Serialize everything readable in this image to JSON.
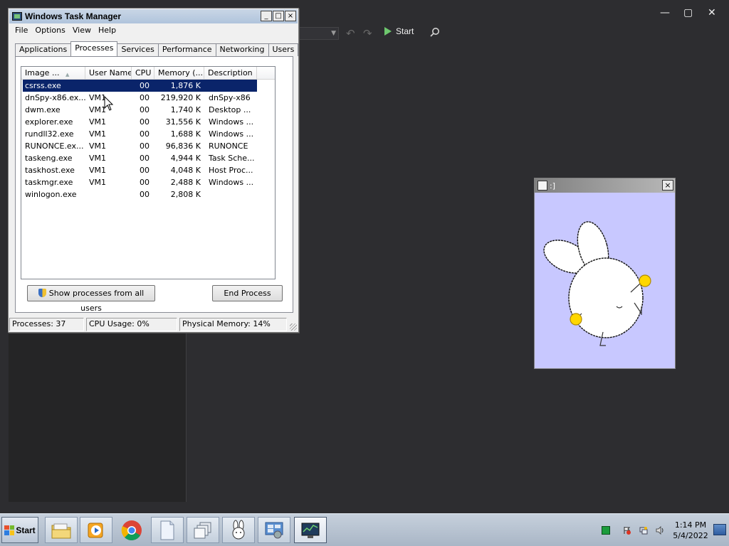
{
  "background_app": {
    "toolbar": {
      "start_label": "Start"
    },
    "window_controls": {
      "minimize": "—",
      "maximize": "▢",
      "close": "✕"
    }
  },
  "task_manager": {
    "title": "Windows Task Manager",
    "title_buttons": {
      "minimize": "_",
      "maximize": "□",
      "close": "×"
    },
    "menu": [
      "File",
      "Options",
      "View",
      "Help"
    ],
    "tabs": [
      "Applications",
      "Processes",
      "Services",
      "Performance",
      "Networking",
      "Users"
    ],
    "active_tab": "Processes",
    "columns": [
      "Image ...",
      "User Name",
      "CPU",
      "Memory (...",
      "Description"
    ],
    "processes": [
      {
        "image": "csrss.exe",
        "user": "",
        "cpu": "00",
        "memory": "1,876 K",
        "description": "",
        "selected": true
      },
      {
        "image": "dnSpy-x86.ex...",
        "user": "VM1",
        "cpu": "00",
        "memory": "219,920 K",
        "description": "dnSpy-x86"
      },
      {
        "image": "dwm.exe",
        "user": "VM1",
        "cpu": "00",
        "memory": "1,740 K",
        "description": "Desktop ..."
      },
      {
        "image": "explorer.exe",
        "user": "VM1",
        "cpu": "00",
        "memory": "31,556 K",
        "description": "Windows ..."
      },
      {
        "image": "rundll32.exe",
        "user": "VM1",
        "cpu": "00",
        "memory": "1,688 K",
        "description": "Windows ..."
      },
      {
        "image": "RUNONCE.ex...",
        "user": "VM1",
        "cpu": "00",
        "memory": "96,836 K",
        "description": "RUNONCE"
      },
      {
        "image": "taskeng.exe",
        "user": "VM1",
        "cpu": "00",
        "memory": "4,944 K",
        "description": "Task Sche..."
      },
      {
        "image": "taskhost.exe",
        "user": "VM1",
        "cpu": "00",
        "memory": "4,048 K",
        "description": "Host Proc..."
      },
      {
        "image": "taskmgr.exe",
        "user": "VM1",
        "cpu": "00",
        "memory": "2,488 K",
        "description": "Windows ..."
      },
      {
        "image": "winlogon.exe",
        "user": "",
        "cpu": "00",
        "memory": "2,808 K",
        "description": ""
      }
    ],
    "show_all_button": "Show processes from all users",
    "end_process_button": "End Process",
    "status": {
      "processes": "Processes: 37",
      "cpu": "CPU Usage: 0%",
      "memory": "Physical Memory: 14%"
    }
  },
  "bunny_window": {
    "title": ":]",
    "close": "×",
    "background_color": "#c8c8ff"
  },
  "taskbar": {
    "start_label": "Start",
    "apps": [
      {
        "icon": "folder-icon",
        "active": false
      },
      {
        "icon": "media-player-icon",
        "active": false
      },
      {
        "icon": "chrome-icon",
        "active": false
      },
      {
        "icon": "document-icon",
        "active": false
      },
      {
        "icon": "window-switch-icon",
        "active": false
      },
      {
        "icon": "bunny-icon",
        "active": false
      },
      {
        "icon": "network-settings-icon",
        "active": false
      },
      {
        "icon": "task-manager-icon",
        "active": true
      }
    ],
    "clock_time": "1:14 PM",
    "clock_date": "5/4/2022"
  }
}
